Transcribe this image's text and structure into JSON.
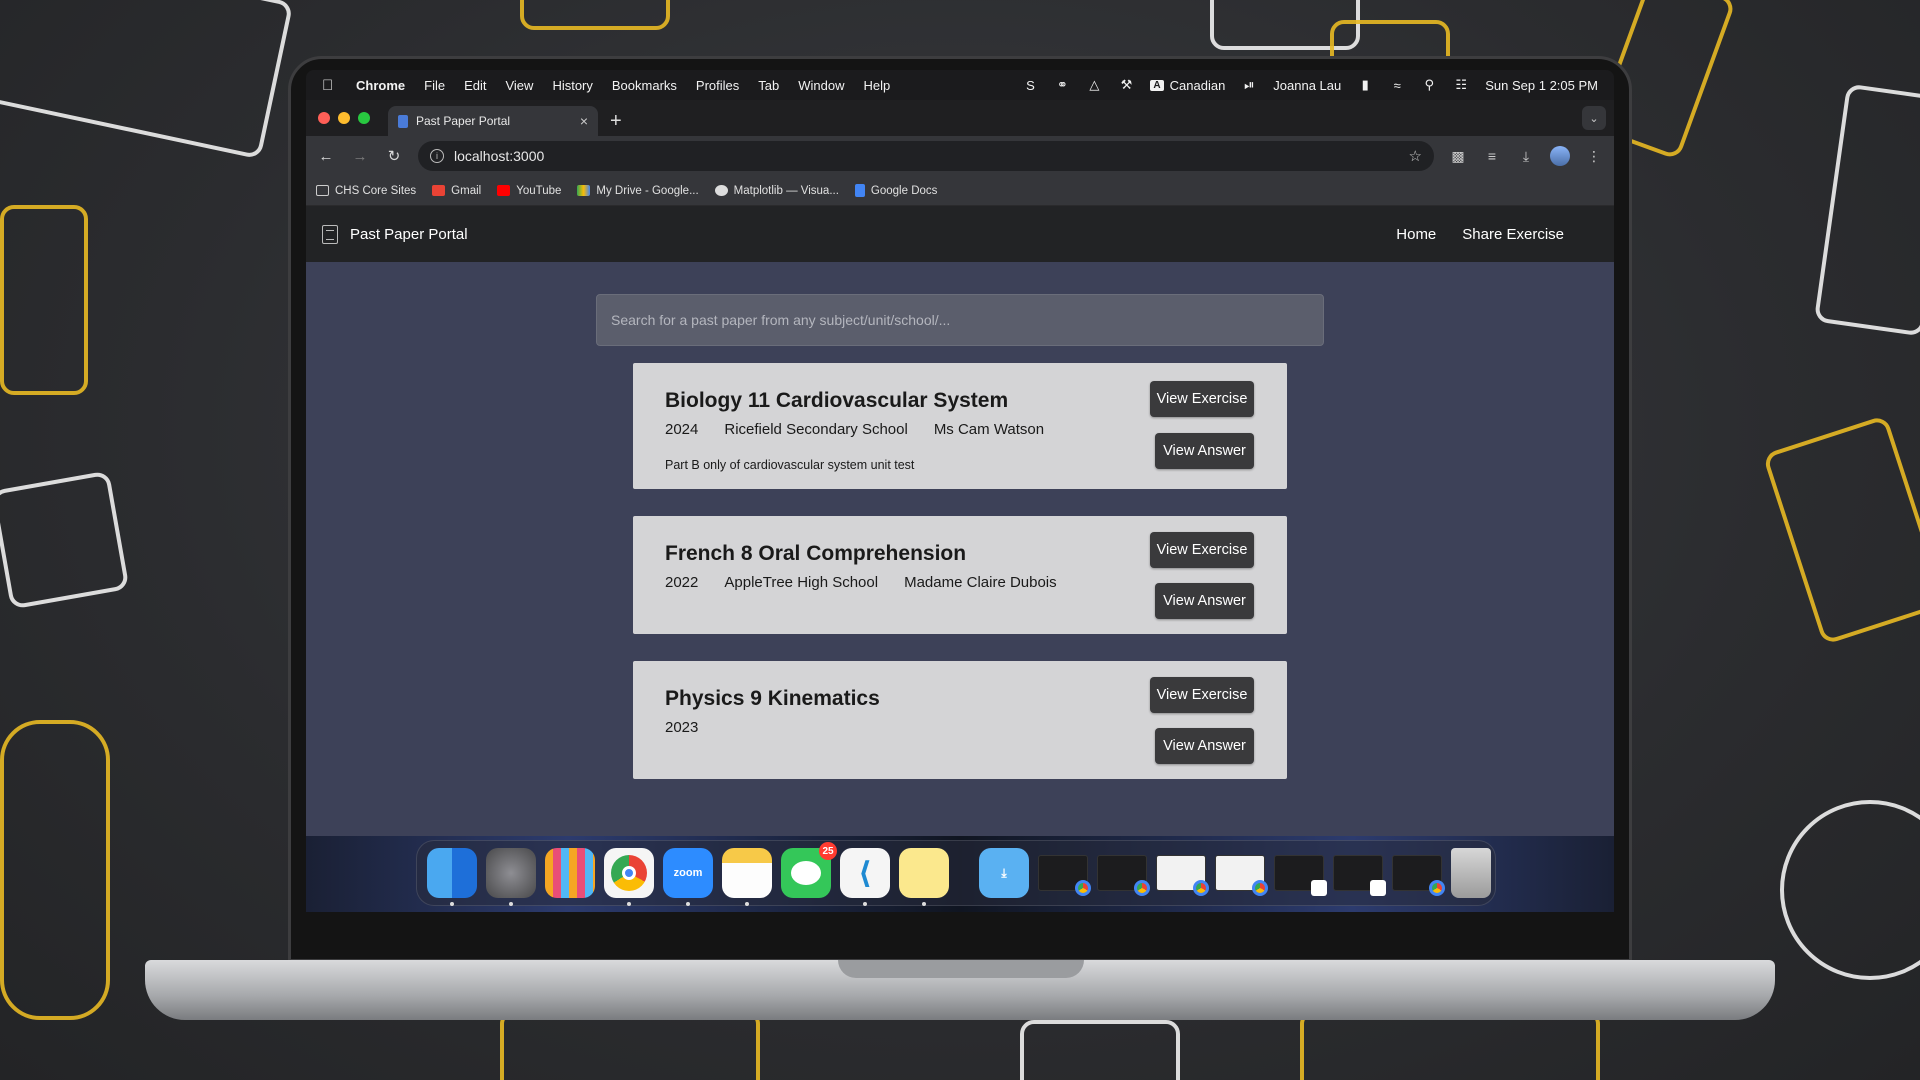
{
  "menubar": {
    "app": "Chrome",
    "items": [
      "File",
      "Edit",
      "View",
      "History",
      "Bookmarks",
      "Profiles",
      "Tab",
      "Window",
      "Help"
    ],
    "input_source": "Canadian",
    "user": "Joanna Lau",
    "datetime": "Sun Sep 1  2:05 PM"
  },
  "tab": {
    "title": "Past Paper Portal",
    "close": "×",
    "new": "+"
  },
  "toolbar": {
    "url": "localhost:3000"
  },
  "bookmarks": [
    "CHS Core Sites",
    "Gmail",
    "YouTube",
    "My Drive - Google...",
    "Matplotlib — Visua...",
    "Google Docs"
  ],
  "site": {
    "brand": "Past Paper Portal",
    "nav": [
      "Home",
      "Share Exercise"
    ],
    "search_placeholder": "Search for a past paper from any subject/unit/school/...",
    "buttons": {
      "view_exercise": "View Exercise",
      "view_answer": "View Answer"
    },
    "papers": [
      {
        "title": "Biology 11 Cardiovascular System",
        "year": "2024",
        "school": "Ricefield Secondary School",
        "teacher": "Ms Cam Watson",
        "description": "Part B only of cardiovascular system unit test"
      },
      {
        "title": "French 8 Oral Comprehension",
        "year": "2022",
        "school": "AppleTree High School",
        "teacher": "Madame Claire Dubois",
        "description": ""
      },
      {
        "title": "Physics 9 Kinematics",
        "year": "2023",
        "school": "",
        "teacher": "",
        "description": ""
      }
    ]
  },
  "dock": {
    "apps": [
      "Finder",
      "System Settings",
      "Launchpad",
      "Chrome",
      "Zoom",
      "Notes",
      "Messages",
      "Visual Studio Code",
      "Stickies"
    ],
    "zoom_label": "zoom",
    "messages_badge": "25"
  },
  "colors": {
    "page_bg": "#3d4158",
    "navbar": "#222325",
    "card": "#d4d4d6",
    "button": "#3a3a3c"
  }
}
